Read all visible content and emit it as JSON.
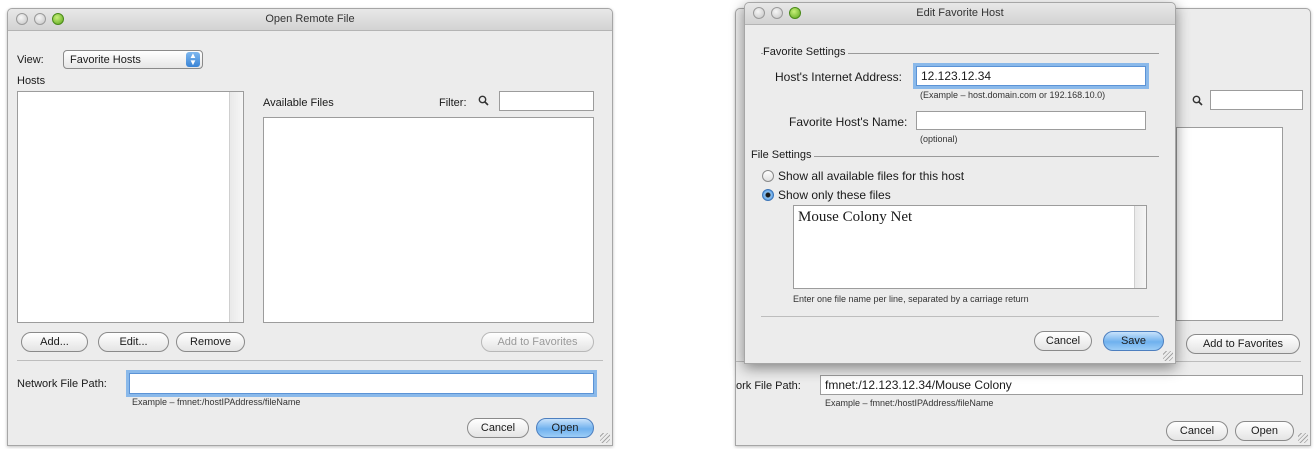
{
  "left_window": {
    "title": "Open Remote File",
    "view_label": "View:",
    "view_value": "Favorite Hosts",
    "hosts_label": "Hosts",
    "available_files_label": "Available Files",
    "filter_label": "Filter:",
    "filter_value": "",
    "buttons": {
      "add": "Add...",
      "edit": "Edit...",
      "remove": "Remove",
      "add_to_favorites": "Add to Favorites",
      "cancel": "Cancel",
      "open": "Open"
    },
    "network_path_label": "Network File Path:",
    "network_path_value": "",
    "network_path_example": "Example – fmnet:/hostIPAddress/fileName"
  },
  "right_window": {
    "background_window": {
      "network_path_label": "ork File Path:",
      "network_path_value": "fmnet:/12.123.12.34/Mouse Colony",
      "network_path_example": "Example – fmnet:/hostIPAddress/fileName",
      "add_to_favorites": "Add to Favorites",
      "cancel": "Cancel",
      "open": "Open"
    },
    "sheet": {
      "title": "Edit Favorite Host",
      "favorite_settings_label": "Favorite Settings",
      "host_address_label": "Host's Internet Address:",
      "host_address_value": "12.123.12.34",
      "host_address_example": "(Example – host.domain.com or 192.168.10.0)",
      "host_name_label": "Favorite Host's Name:",
      "host_name_value": "",
      "host_name_hint": "(optional)",
      "file_settings_label": "File Settings",
      "radio_all": "Show all available files for this host",
      "radio_only": "Show only these files",
      "files_text": "Mouse Colony Net",
      "files_hint": "Enter one file name per line, separated by a carriage return",
      "cancel": "Cancel",
      "save": "Save"
    }
  },
  "colors": {
    "window_bg": "#ececec",
    "default_button": "#6fb1ee",
    "focus_ring": "#8ab9ea"
  }
}
